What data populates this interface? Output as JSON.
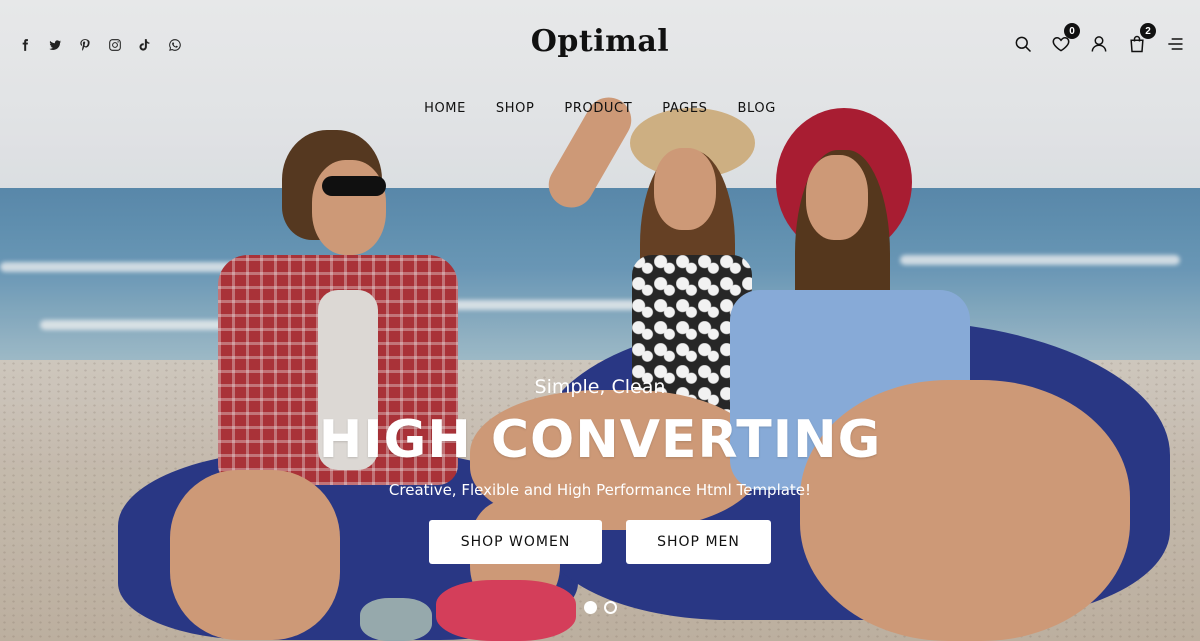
{
  "brand": {
    "logo": "Optimal"
  },
  "social": {
    "icons": [
      "facebook-icon",
      "twitter-icon",
      "pinterest-icon",
      "instagram-icon",
      "tiktok-icon",
      "whatsapp-icon"
    ]
  },
  "nav": {
    "items": [
      "HOME",
      "SHOP",
      "PRODUCT",
      "PAGES",
      "BLOG"
    ]
  },
  "tools": {
    "wishlist_count": "0",
    "cart_count": "2"
  },
  "hero": {
    "kicker": "Simple, Clean",
    "headline": "HIGH CONVERTING",
    "subline": "Creative, Flexible and High Performance Html Template!",
    "cta_women": "SHOP WOMEN",
    "cta_men": "SHOP MEN",
    "slides_total": 2,
    "active_slide": 1
  },
  "colors": {
    "text_dark": "#111111",
    "button_bg": "#ffffff",
    "badge_bg": "#111111"
  }
}
